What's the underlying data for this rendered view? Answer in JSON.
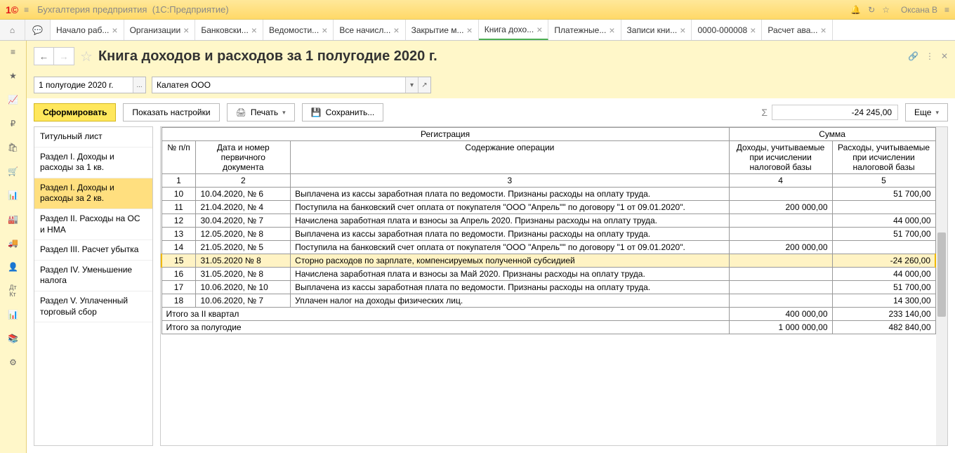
{
  "titlebar": {
    "app": "Бухгалтерия предприятия",
    "suffix": "(1С:Предприятие)",
    "user": "Оксана В"
  },
  "tabs": [
    {
      "label": "Начало раб...",
      "active": false
    },
    {
      "label": "Организации",
      "active": false
    },
    {
      "label": "Банковски...",
      "active": false
    },
    {
      "label": "Ведомости...",
      "active": false
    },
    {
      "label": "Все начисл...",
      "active": false
    },
    {
      "label": "Закрытие м...",
      "active": false
    },
    {
      "label": "Книга дохо...",
      "active": true
    },
    {
      "label": "Платежные...",
      "active": false
    },
    {
      "label": "Записи кни...",
      "active": false
    },
    {
      "label": "0000-000008",
      "active": false
    },
    {
      "label": "Расчет ава...",
      "active": false
    }
  ],
  "page": {
    "title": "Книга доходов и расходов за 1 полугодие 2020 г."
  },
  "filters": {
    "period": "1 полугодие 2020 г.",
    "org": "Калатея ООО"
  },
  "toolbar": {
    "form": "Сформировать",
    "settings": "Показать настройки",
    "print": "Печать",
    "save": "Сохранить...",
    "more": "Еще",
    "sum": "-24 245,00"
  },
  "sections": [
    "Титульный лист",
    "Раздел I. Доходы и расходы за 1 кв.",
    "Раздел I. Доходы и расходы за 2 кв.",
    "Раздел II. Расходы на ОС и НМА",
    "Раздел III. Расчет убытка",
    "Раздел IV. Уменьшение налога",
    "Раздел V. Уплаченный торговый сбор"
  ],
  "selectedSection": 2,
  "grid": {
    "header1": {
      "reg": "Регистрация",
      "sum": "Сумма"
    },
    "header2": {
      "num": "№ п/п",
      "doc": "Дата и номер первичного документа",
      "desc": "Содержание операции",
      "income": "Доходы, учитываемые при исчислении налоговой базы",
      "expense": "Расходы, учитываемые при исчислении налоговой базы"
    },
    "colnums": [
      "1",
      "2",
      "3",
      "4",
      "5"
    ],
    "rows": [
      {
        "n": "10",
        "doc": "10.04.2020, № 6",
        "desc": "Выплачена из кассы заработная плата по ведомости. Признаны расходы на оплату труда.",
        "inc": "",
        "exp": "51 700,00"
      },
      {
        "n": "11",
        "doc": "21.04.2020, № 4",
        "desc": "Поступила на банковский счет оплата от покупателя \"ООО \"Апрель\"\" по договору \"1 от 09.01.2020\".",
        "inc": "200 000,00",
        "exp": ""
      },
      {
        "n": "12",
        "doc": "30.04.2020, № 7",
        "desc": "Начислена заработная плата и взносы за Апрель 2020. Признаны расходы на оплату труда.",
        "inc": "",
        "exp": "44 000,00"
      },
      {
        "n": "13",
        "doc": "12.05.2020, № 8",
        "desc": "Выплачена из кассы заработная плата по ведомости. Признаны расходы на оплату труда.",
        "inc": "",
        "exp": "51 700,00"
      },
      {
        "n": "14",
        "doc": "21.05.2020, № 5",
        "desc": "Поступила на банковский счет оплата от покупателя \"ООО \"Апрель\"\" по договору \"1 от 09.01.2020\".",
        "inc": "200 000,00",
        "exp": ""
      },
      {
        "n": "15",
        "doc": "31.05.2020 № 8",
        "desc": "Сторно расходов по зарплате, компенсируемых полученной субсидией",
        "inc": "",
        "exp": "-24 260,00",
        "hl": true
      },
      {
        "n": "16",
        "doc": "31.05.2020, № 8",
        "desc": "Начислена заработная плата и взносы за Май 2020. Признаны расходы на оплату труда.",
        "inc": "",
        "exp": "44 000,00"
      },
      {
        "n": "17",
        "doc": "10.06.2020, № 10",
        "desc": "Выплачена из кассы заработная плата по ведомости. Признаны расходы на оплату труда.",
        "inc": "",
        "exp": "51 700,00"
      },
      {
        "n": "18",
        "doc": "10.06.2020, № 7",
        "desc": "Уплачен налог на доходы физических лиц.",
        "inc": "",
        "exp": "14 300,00"
      }
    ],
    "totals": [
      {
        "label": "Итого за II квартал",
        "inc": "400 000,00",
        "exp": "233 140,00"
      },
      {
        "label": "Итого за полугодие",
        "inc": "1 000 000,00",
        "exp": "482 840,00"
      }
    ]
  }
}
